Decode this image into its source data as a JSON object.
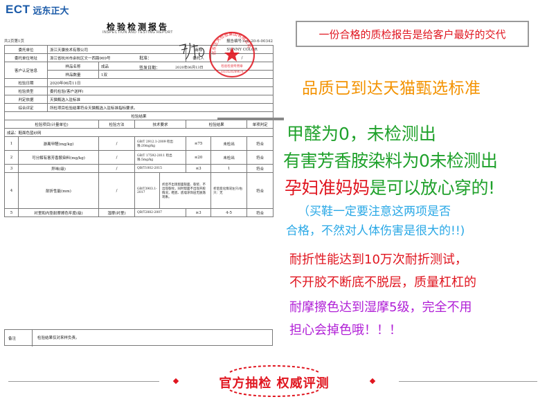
{
  "logo": {
    "ect": "ECT",
    "cn": "远东正大"
  },
  "report": {
    "title": "检验检测报告",
    "subtitle": "INSPECTION AND TESTING REPORT",
    "page": "共2页第1页",
    "report_no": "报告编号:sen-20-6-00342",
    "rows": {
      "client_label": "委托单位",
      "client_value": "浙江天骥技术有限公司",
      "brand_label": "商标",
      "brand_value": "SUNNY COLOR",
      "client_addr_label": "委托单位地址",
      "client_addr_value": "浙江省杭州市余杭区文一西路969号",
      "agent_label": "委托人",
      "agent_value": "/",
      "sample_info_label": "客户认定信息",
      "sample_name_label": "样品名称",
      "sample_name_value": "成品",
      "sample_qty_label": "样品数量",
      "sample_qty_value": "1双",
      "date_label": "检验日期",
      "date_value": "2020年06月11日",
      "type_label": "检验类型",
      "type_value": "委托检验(客户送样)",
      "basis_label": "判定依据",
      "basis_value": "天猫甄选入驻标准",
      "summary_label": "综合评定",
      "summary_value": "所检项目检验结果符合天猫甄选入驻标准指标要求。",
      "results_header": "检验结果"
    },
    "columns": [
      "检验项目(计量单位)",
      "检验方法",
      "技术要求",
      "检验结果",
      "单项判定"
    ],
    "section": "成品：鞋面色蓝纱网",
    "items": [
      {
        "no": "1",
        "name": "游离甲醛(mg/kg)",
        "method": "/",
        "std": "GB/T 2912.1-2009 检出限:20mg/kg",
        "req": "≤75",
        "result": "未检出",
        "verdict": "符合"
      },
      {
        "no": "2",
        "name": "可分解有害芳香胺染料(mg/kg)",
        "method": "/",
        "std": "GB/T 17592-2011 检出限:5mg/kg",
        "req": "≤20",
        "result": "未检出",
        "verdict": "符合"
      },
      {
        "no": "3",
        "name": "异味(级)",
        "method": "/",
        "std": "QB/T1002-2015",
        "req": "≤3",
        "result": "1",
        "verdict": "符合"
      },
      {
        "no": "4",
        "name": "耐折性能(mm)",
        "method": "/",
        "std": "GB/T3903.1-2017",
        "req": "折后不出现帮面裂面、裂浆、不出现裂纹，同时帮面不出现开胶情况，鞋底、底墙涂饰层无脱落现象。",
        "result": "折后变化情况左只/右只：无",
        "verdict": "符合"
      },
      {
        "no": "5",
        "name": "衬里和内垫耐摩擦色牢度(级)",
        "method": "湿摩(衬里)",
        "std": "QB/T2882-2007",
        "req": "≥3",
        "result": "4-5",
        "verdict": "符合"
      }
    ],
    "approve_label": "批准：",
    "issue_date_label": "签发日期：",
    "issue_date_value": "2020年06月13日",
    "stamp_text": "远东正大检验集团有限公司",
    "stamp_sub": "检验检测专用章",
    "stamp_code": "3310520289674",
    "remark_label": "备注",
    "remark_value": "检验结果仅对来样负责。"
  },
  "annotations": {
    "box": "一份合格的质检报告是给客户最好的交代",
    "quality": "品质已到达天猫甄选标准",
    "formaldehyde": "甲醛为0，未检测出",
    "dye": "有害芳香胺染料为0未检测出",
    "preg_red": "孕妇准妈妈",
    "preg_green": "是可以放心穿的!",
    "note_line1": "（买鞋一定要注意这两项是否",
    "note_line2": "合格，不然对人体伤害是很大的!!)",
    "fold_line1": "耐折性能达到10万次耐折测试，",
    "fold_line2": "不开胶不断底不脱层，质量杠杠的",
    "rub_line1": "耐摩擦色达到湿摩5级，完全不用",
    "rub_line2": "担心会掉色哦！！！"
  },
  "banner": {
    "text": "官方抽检 权威评测"
  },
  "colors": {
    "red": "#e0151f",
    "orange": "#f39200",
    "green": "#1fa12b",
    "blue": "#2aa8e6",
    "purple": "#b01fd6",
    "logo_blue": "#1a5aa8"
  }
}
